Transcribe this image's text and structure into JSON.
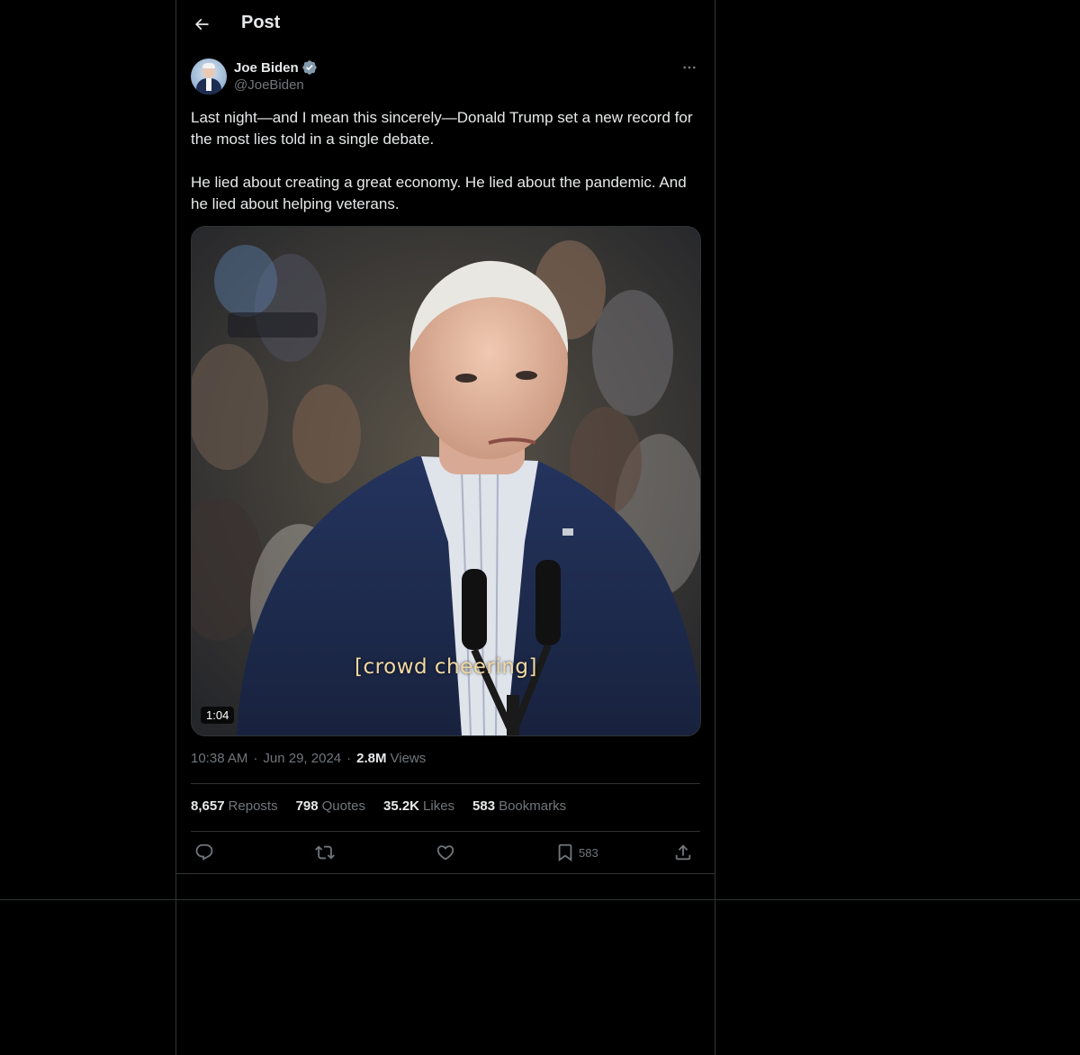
{
  "header": {
    "title": "Post"
  },
  "author": {
    "display_name": "Joe Biden",
    "handle": "@JoeBiden",
    "verified": true
  },
  "post": {
    "text": "Last night—and I mean this sincerely—Donald Trump set a new record for the most lies told in a single debate.\n\nHe lied about creating a great economy. He lied about the pandemic. And he lied about helping veterans.",
    "media": {
      "caption": "[crowd cheering]",
      "duration": "1:04"
    },
    "time": "10:38 AM",
    "date": "Jun 29, 2024",
    "separator": "·",
    "views_count": "2.8M",
    "views_label": "Views"
  },
  "stats": {
    "reposts_count": "8,657",
    "reposts_label": "Reposts",
    "quotes_count": "798",
    "quotes_label": "Quotes",
    "likes_count": "35.2K",
    "likes_label": "Likes",
    "bookmarks_count": "583",
    "bookmarks_label": "Bookmarks"
  },
  "actions": {
    "bookmark_count": "583"
  },
  "icons": {
    "back": "arrow-left-icon",
    "verified": "verified-badge-icon",
    "more": "more-horizontal-icon",
    "reply": "reply-icon",
    "repost": "repost-icon",
    "like": "heart-icon",
    "bookmark": "bookmark-icon",
    "share": "share-icon"
  },
  "colors": {
    "background": "#000000",
    "border": "#2f3336",
    "text_primary": "#e7e9ea",
    "text_secondary": "#71767b",
    "verified_badge": "#829aab",
    "caption": "#f1d9a4"
  }
}
